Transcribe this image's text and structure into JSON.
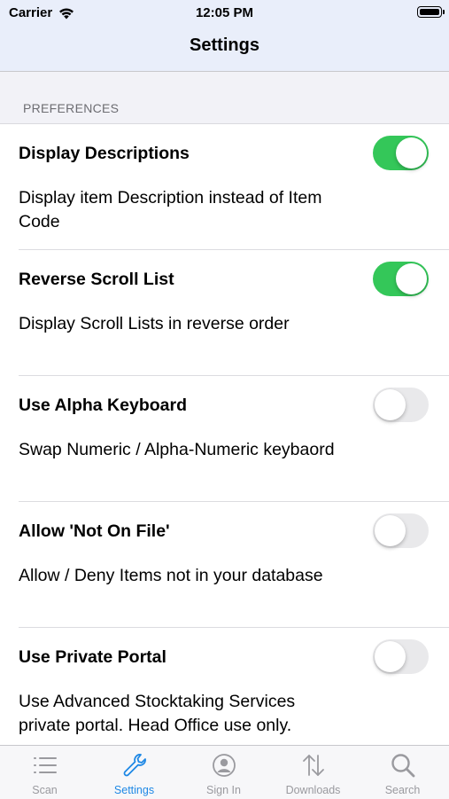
{
  "status_bar": {
    "carrier": "Carrier",
    "time": "12:05 PM"
  },
  "nav": {
    "title": "Settings"
  },
  "section": {
    "header": "PREFERENCES"
  },
  "settings": [
    {
      "title": "Display Descriptions",
      "description": "Display item Description instead of Item Code",
      "enabled": true
    },
    {
      "title": "Reverse Scroll List",
      "description": "Display Scroll Lists in reverse order",
      "enabled": true
    },
    {
      "title": "Use Alpha Keyboard",
      "description": "Swap Numeric / Alpha-Numeric keybaord",
      "enabled": false
    },
    {
      "title": "Allow 'Not On File'",
      "description": "Allow / Deny Items not in your database",
      "enabled": false
    },
    {
      "title": "Use Private Portal",
      "description": "Use Advanced Stocktaking Services private portal. Head Office use only.",
      "enabled": false
    }
  ],
  "tabbar": {
    "active": "Settings",
    "items": [
      {
        "label": "Scan",
        "icon": "list-icon"
      },
      {
        "label": "Settings",
        "icon": "wrench-icon"
      },
      {
        "label": "Sign In",
        "icon": "person-circle-icon"
      },
      {
        "label": "Downloads",
        "icon": "up-down-arrows-icon"
      },
      {
        "label": "Search",
        "icon": "magnifier-icon"
      }
    ]
  },
  "colors": {
    "toggle_on": "#34c759",
    "toggle_off": "#e9e9eb",
    "tab_active": "#1e88e5",
    "tab_inactive": "#9a9a9f",
    "header_bg": "#e9eefa"
  }
}
